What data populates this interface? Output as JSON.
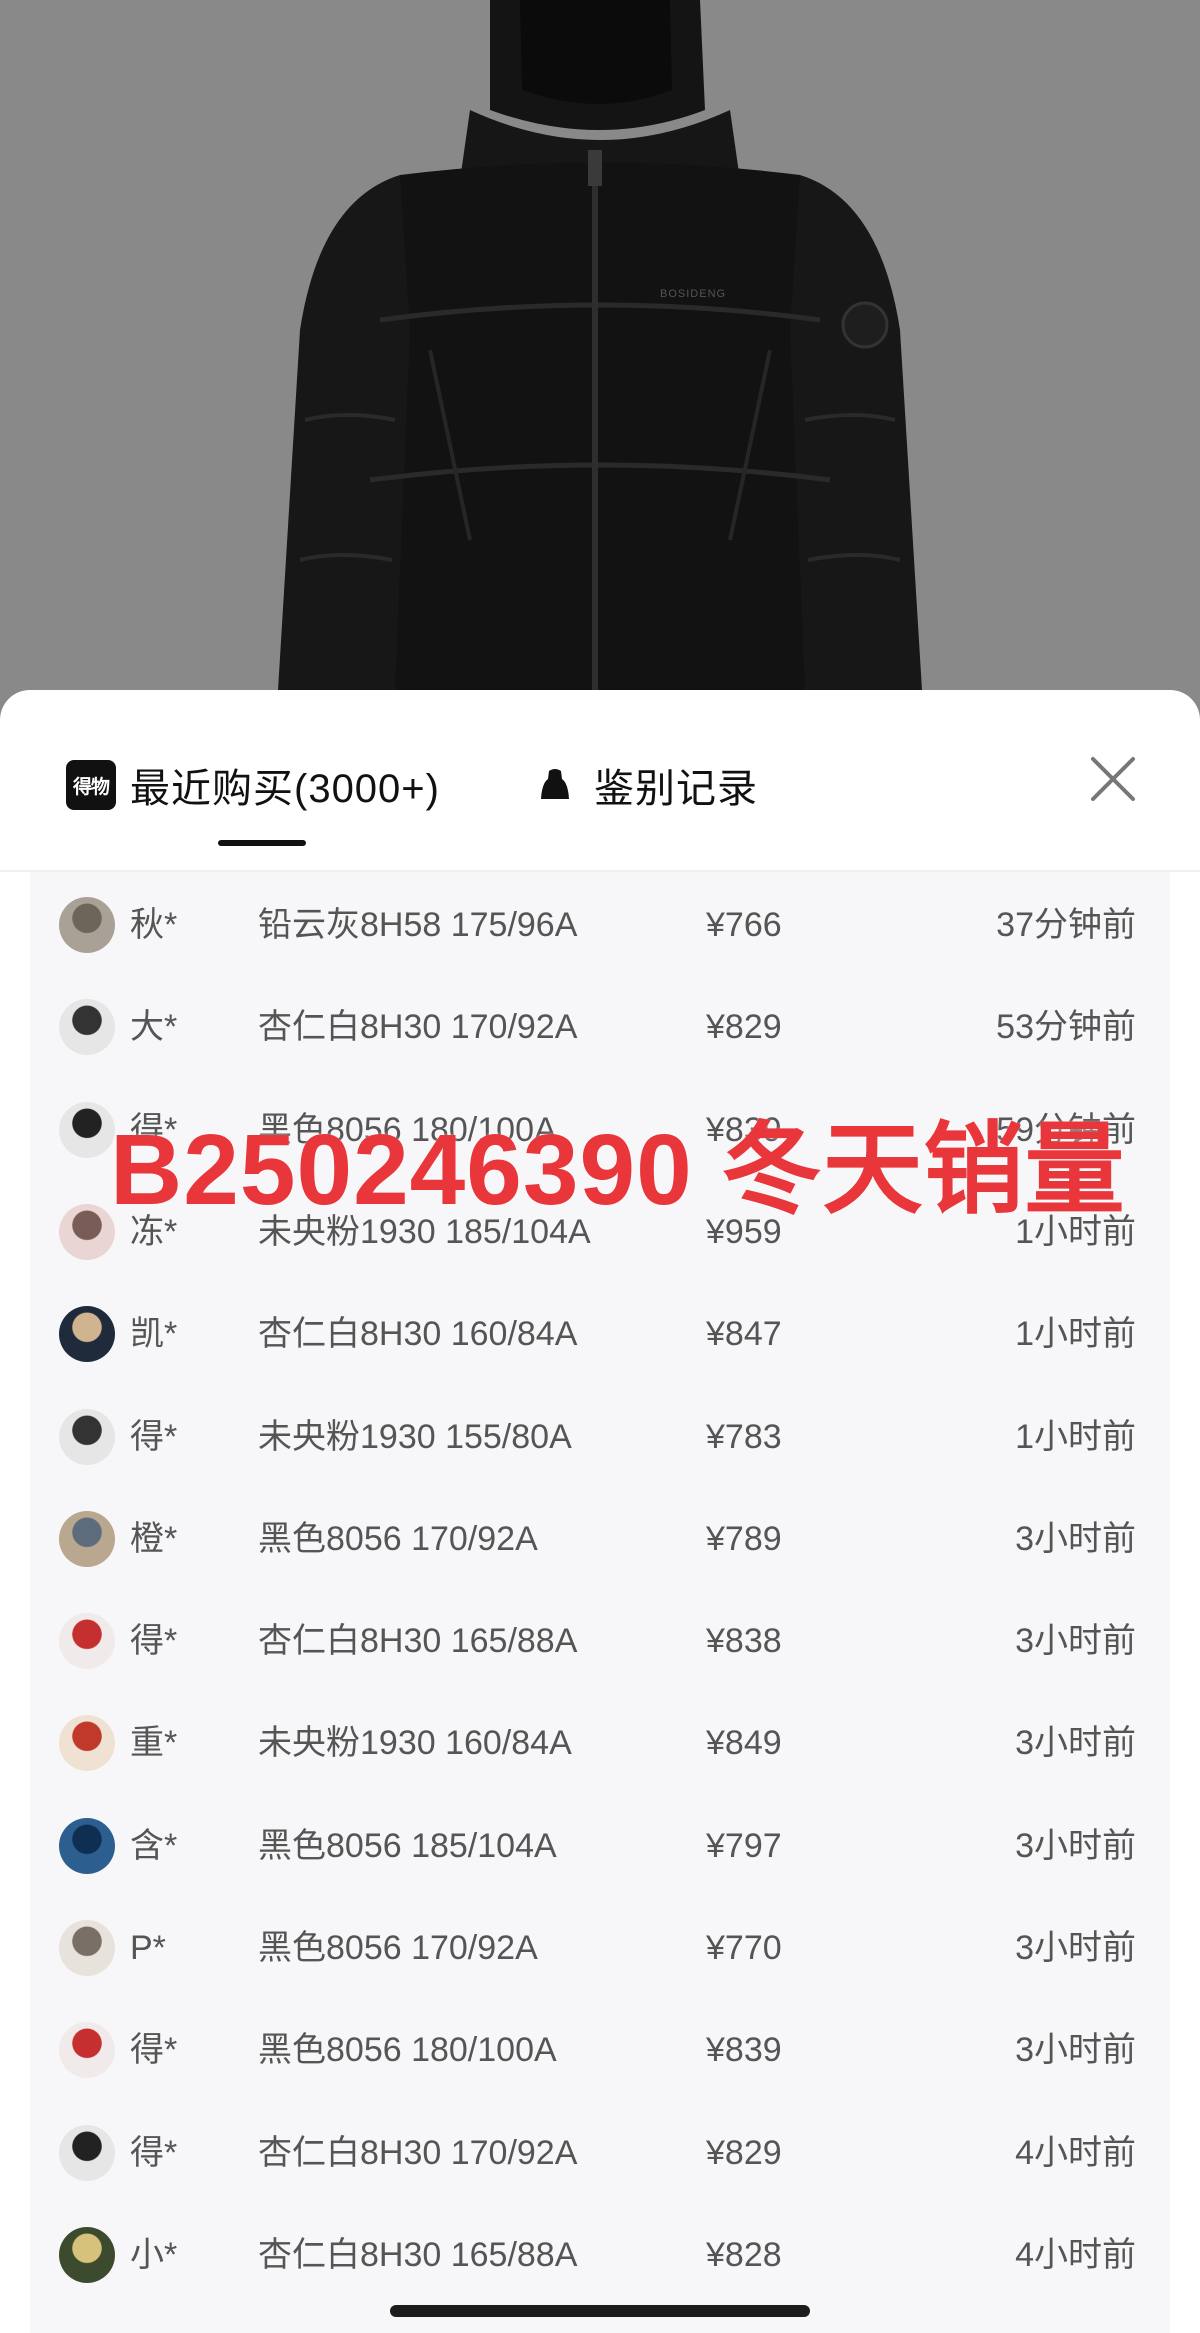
{
  "tabs": [
    {
      "label": "最近购买(3000+)",
      "icon": "dewu-logo-icon",
      "active": true,
      "logo_text": "得物"
    },
    {
      "label": "鉴别记录",
      "icon": "authentication-icon",
      "active": false
    }
  ],
  "records": [
    {
      "user": "秋*",
      "spec": "铅云灰8H58 175/96A",
      "price": "¥766",
      "time": "37分钟前"
    },
    {
      "user": "大*",
      "spec": "杏仁白8H30 170/92A",
      "price": "¥829",
      "time": "53分钟前"
    },
    {
      "user": "得*",
      "spec": "黑色8056 180/100A",
      "price": "¥839",
      "time": "59分钟前"
    },
    {
      "user": "冻*",
      "spec": "未央粉1930 185/104A",
      "price": "¥959",
      "time": "1小时前"
    },
    {
      "user": "凯*",
      "spec": "杏仁白8H30 160/84A",
      "price": "¥847",
      "time": "1小时前"
    },
    {
      "user": "得*",
      "spec": "未央粉1930 155/80A",
      "price": "¥783",
      "time": "1小时前"
    },
    {
      "user": "橙*",
      "spec": "黑色8056 170/92A",
      "price": "¥789",
      "time": "3小时前"
    },
    {
      "user": "得*",
      "spec": "杏仁白8H30 165/88A",
      "price": "¥838",
      "time": "3小时前"
    },
    {
      "user": "重*",
      "spec": "未央粉1930 160/84A",
      "price": "¥849",
      "time": "3小时前"
    },
    {
      "user": "含*",
      "spec": "黑色8056 185/104A",
      "price": "¥797",
      "time": "3小时前"
    },
    {
      "user": "P*",
      "spec": "黑色8056 170/92A",
      "price": "¥770",
      "time": "3小时前"
    },
    {
      "user": "得*",
      "spec": "黑色8056 180/100A",
      "price": "¥839",
      "time": "3小时前"
    },
    {
      "user": "得*",
      "spec": "杏仁白8H30 170/92A",
      "price": "¥829",
      "time": "4小时前"
    },
    {
      "user": "小*",
      "spec": "杏仁白8H30 165/88A",
      "price": "¥828",
      "time": "4小时前"
    }
  ],
  "watermark": "B250246390 冬天销量",
  "product_logo_text": "BOSIDENG",
  "colors": {
    "accent": "#e8363b",
    "text_primary": "#111111",
    "text_secondary": "#555555",
    "list_bg": "#f7f7f9",
    "hero_bg": "#898989"
  }
}
